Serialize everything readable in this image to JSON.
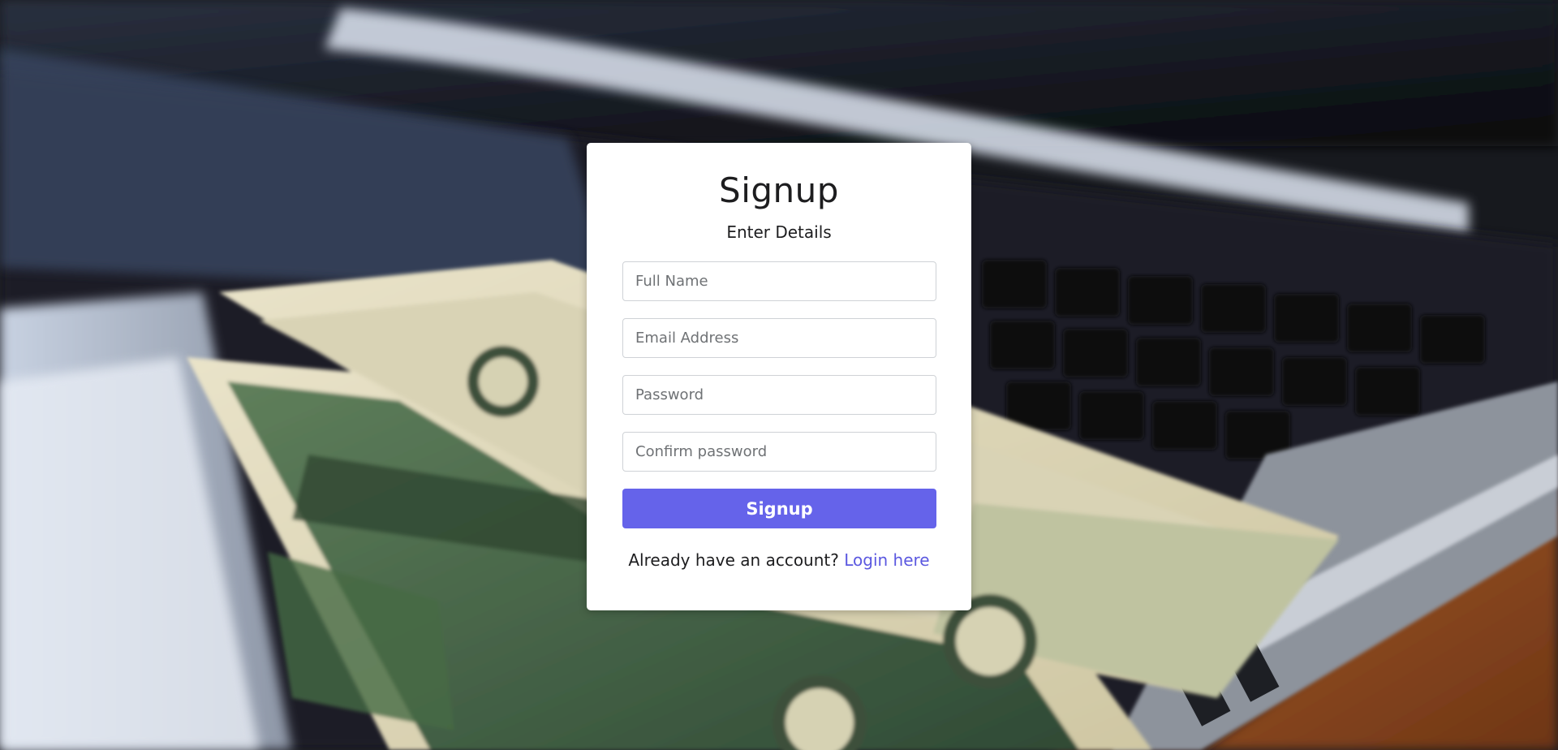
{
  "background": {
    "description_icon": "laptop-with-dollar-bills-photo"
  },
  "signup": {
    "title": "Signup",
    "subtitle": "Enter Details",
    "fields": {
      "full_name_placeholder": "Full Name",
      "email_placeholder": "Email Address",
      "password_placeholder": "Password",
      "confirm_password_placeholder": "Confirm password"
    },
    "submit_label": "Signup",
    "footer_text": "Already have an account?",
    "login_link": "Login here"
  },
  "colors": {
    "accent": "#6563ea",
    "link": "#5b58e0",
    "card": "#ffffff"
  }
}
